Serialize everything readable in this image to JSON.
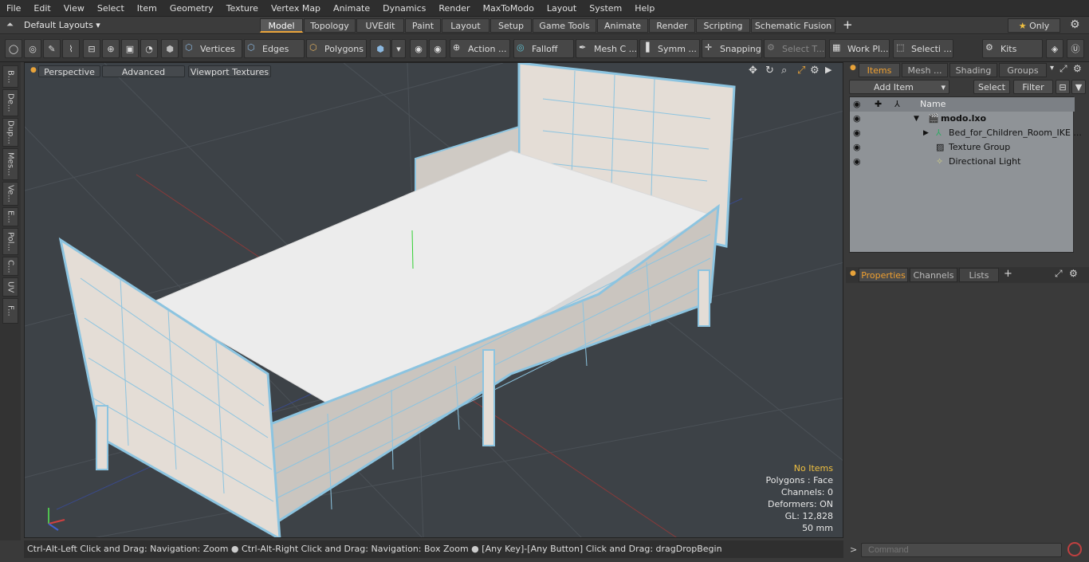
{
  "menu": [
    "File",
    "Edit",
    "View",
    "Select",
    "Item",
    "Geometry",
    "Texture",
    "Vertex Map",
    "Animate",
    "Dynamics",
    "Render",
    "MaxToModo",
    "Layout",
    "System",
    "Help"
  ],
  "layout": {
    "selector": "Default Layouts ▾",
    "tabs": [
      "Model",
      "Topology",
      "UVEdit",
      "Paint",
      "Layout",
      "Setup",
      "Game Tools",
      "Animate",
      "Render",
      "Scripting",
      "Schematic Fusion"
    ],
    "only": "Only"
  },
  "toolbar": {
    "vertices": "Vertices",
    "edges": "Edges",
    "polygons": "Polygons",
    "action": "Action ...",
    "falloff": "Falloff",
    "mesh": "Mesh C ...",
    "symm": "Symm ...",
    "snapping": "Snapping",
    "select_t": "Select T...",
    "work_plane": "Work Pl...",
    "selecti": "Selecti ...",
    "kits": "Kits"
  },
  "left_tabs": [
    "B...",
    "De...",
    "Dup...",
    "Mes...",
    "Ve...",
    "E...",
    "Pol...",
    "C...",
    "UV",
    "F..."
  ],
  "viewport": {
    "perspective": "Perspective",
    "advanced": "Advanced",
    "textures": "Viewport Textures"
  },
  "stats": {
    "no_items": "No Items",
    "polygons": "Polygons : Face",
    "channels": "Channels: 0",
    "deformers": "Deformers: ON",
    "gl": "GL: 12,828",
    "scale": "50 mm"
  },
  "status": {
    "hint1": "Ctrl-Alt-Left Click and Drag: Navigation: Zoom",
    "hint2": "Ctrl-Alt-Right Click and Drag: Navigation: Box Zoom",
    "hint3": "[Any Key]-[Any Button] Click and Drag: dragDropBegin"
  },
  "items_panel": {
    "tabs": [
      "Items",
      "Mesh ...",
      "Shading",
      "Groups"
    ],
    "add_item": "Add Item",
    "select": "Select",
    "filter": "Filter",
    "name_col": "Name",
    "tree": [
      {
        "label": "modo.lxo"
      },
      {
        "label": "Bed_for_Children_Room_IKE ..."
      },
      {
        "label": "Texture Group"
      },
      {
        "label": "Directional Light"
      }
    ]
  },
  "props_panel": {
    "tabs": [
      "Properties",
      "Channels",
      "Lists"
    ]
  },
  "command": {
    "placeholder": "Command"
  }
}
